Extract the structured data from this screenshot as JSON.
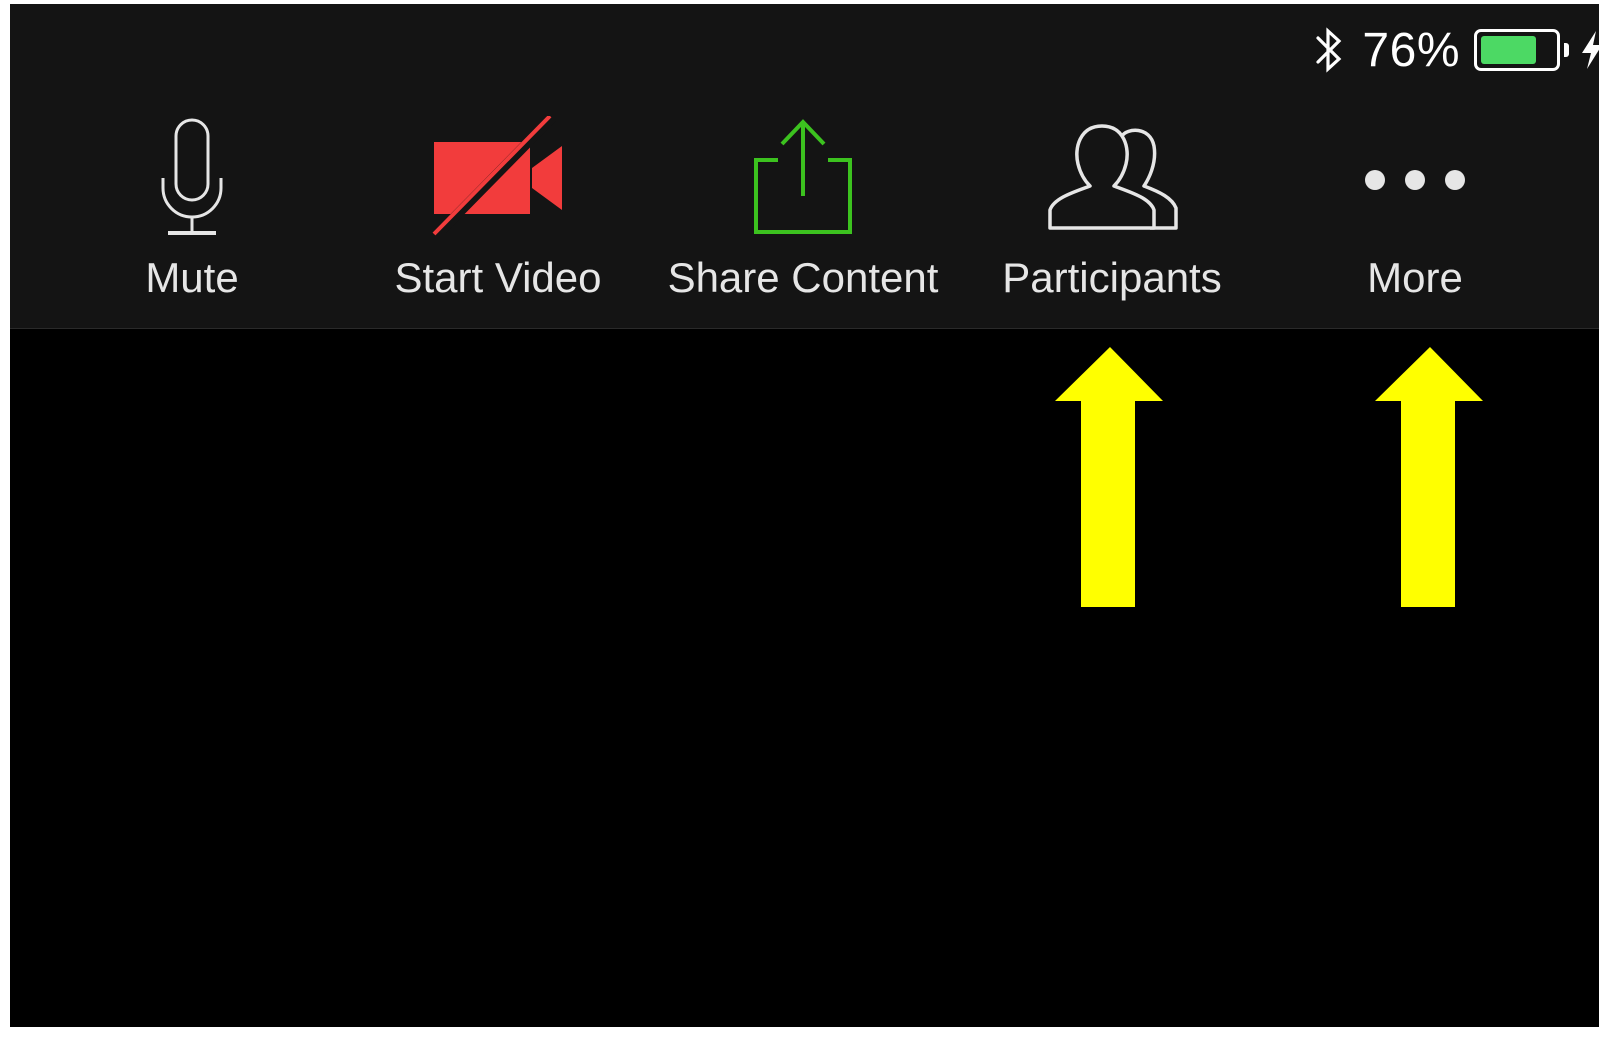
{
  "status_bar": {
    "bluetooth_icon": "bluetooth-icon",
    "battery_percent": "76%",
    "battery_level": 0.76,
    "charging_icon": "bolt-icon"
  },
  "toolbar": {
    "items": [
      {
        "label": "Mute",
        "icon": "microphone-icon",
        "color": "#e6e6e6"
      },
      {
        "label": "Start Video",
        "icon": "video-off-icon",
        "color": "#f23c3c"
      },
      {
        "label": "Share Content",
        "icon": "share-icon",
        "color": "#3cc21f"
      },
      {
        "label": "Participants",
        "icon": "participants-icon",
        "color": "#e6e6e6"
      },
      {
        "label": "More",
        "icon": "more-icon",
        "color": "#e6e6e6"
      }
    ]
  },
  "annotations": {
    "arrow_color": "#ffff00",
    "arrows": [
      "arrow-icon",
      "arrow-icon"
    ]
  },
  "colors": {
    "toolbar_bg": "#141414",
    "screen_bg": "#000000",
    "battery_fill": "#4cd964"
  }
}
